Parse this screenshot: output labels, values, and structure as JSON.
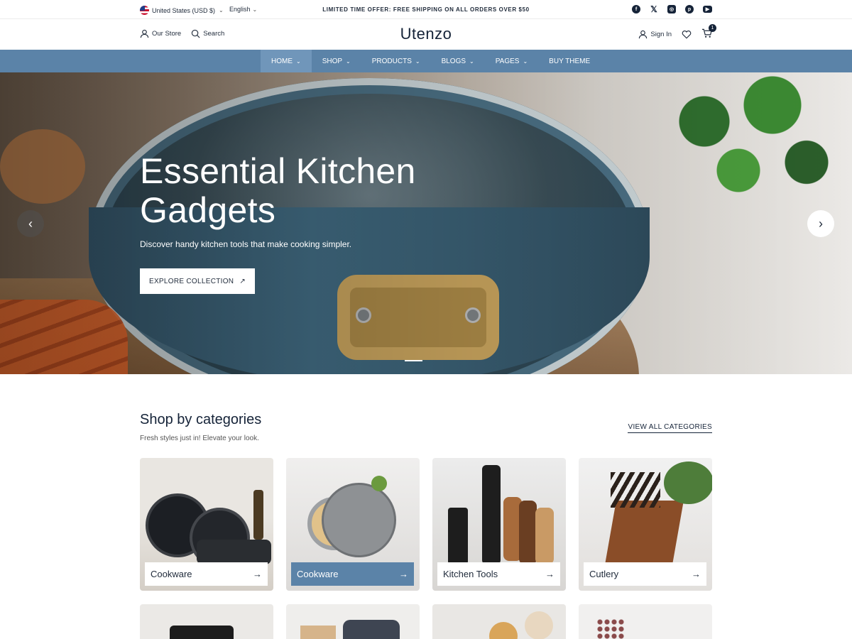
{
  "topbar": {
    "currency": "United States (USD $)",
    "language": "English",
    "offer": "LIMITED TIME OFFER: FREE SHIPPING ON ALL ORDERS OVER $50"
  },
  "header": {
    "our_store": "Our Store",
    "search": "Search",
    "logo": "Utenzo",
    "sign_in": "Sign In",
    "cart_count": "1"
  },
  "nav": {
    "items": [
      {
        "label": "HOME"
      },
      {
        "label": "SHOP"
      },
      {
        "label": "PRODUCTS"
      },
      {
        "label": "BLOGS"
      },
      {
        "label": "PAGES"
      },
      {
        "label": "BUY THEME"
      }
    ]
  },
  "hero": {
    "title": "Essential Kitchen Gadgets",
    "subtitle": "Discover handy kitchen tools that make cooking simpler.",
    "cta": "EXPLORE COLLECTION"
  },
  "categories": {
    "title": "Shop by categories",
    "subtitle": "Fresh styles just in! Elevate your look.",
    "view_all": "VIEW ALL CATEGORIES",
    "cards": [
      {
        "label": "Cookware"
      },
      {
        "label": "Cookware"
      },
      {
        "label": "Kitchen Tools"
      },
      {
        "label": "Cutlery"
      }
    ]
  },
  "colors": {
    "nav_bg": "#5b83a8",
    "brand_dark": "#152338"
  }
}
